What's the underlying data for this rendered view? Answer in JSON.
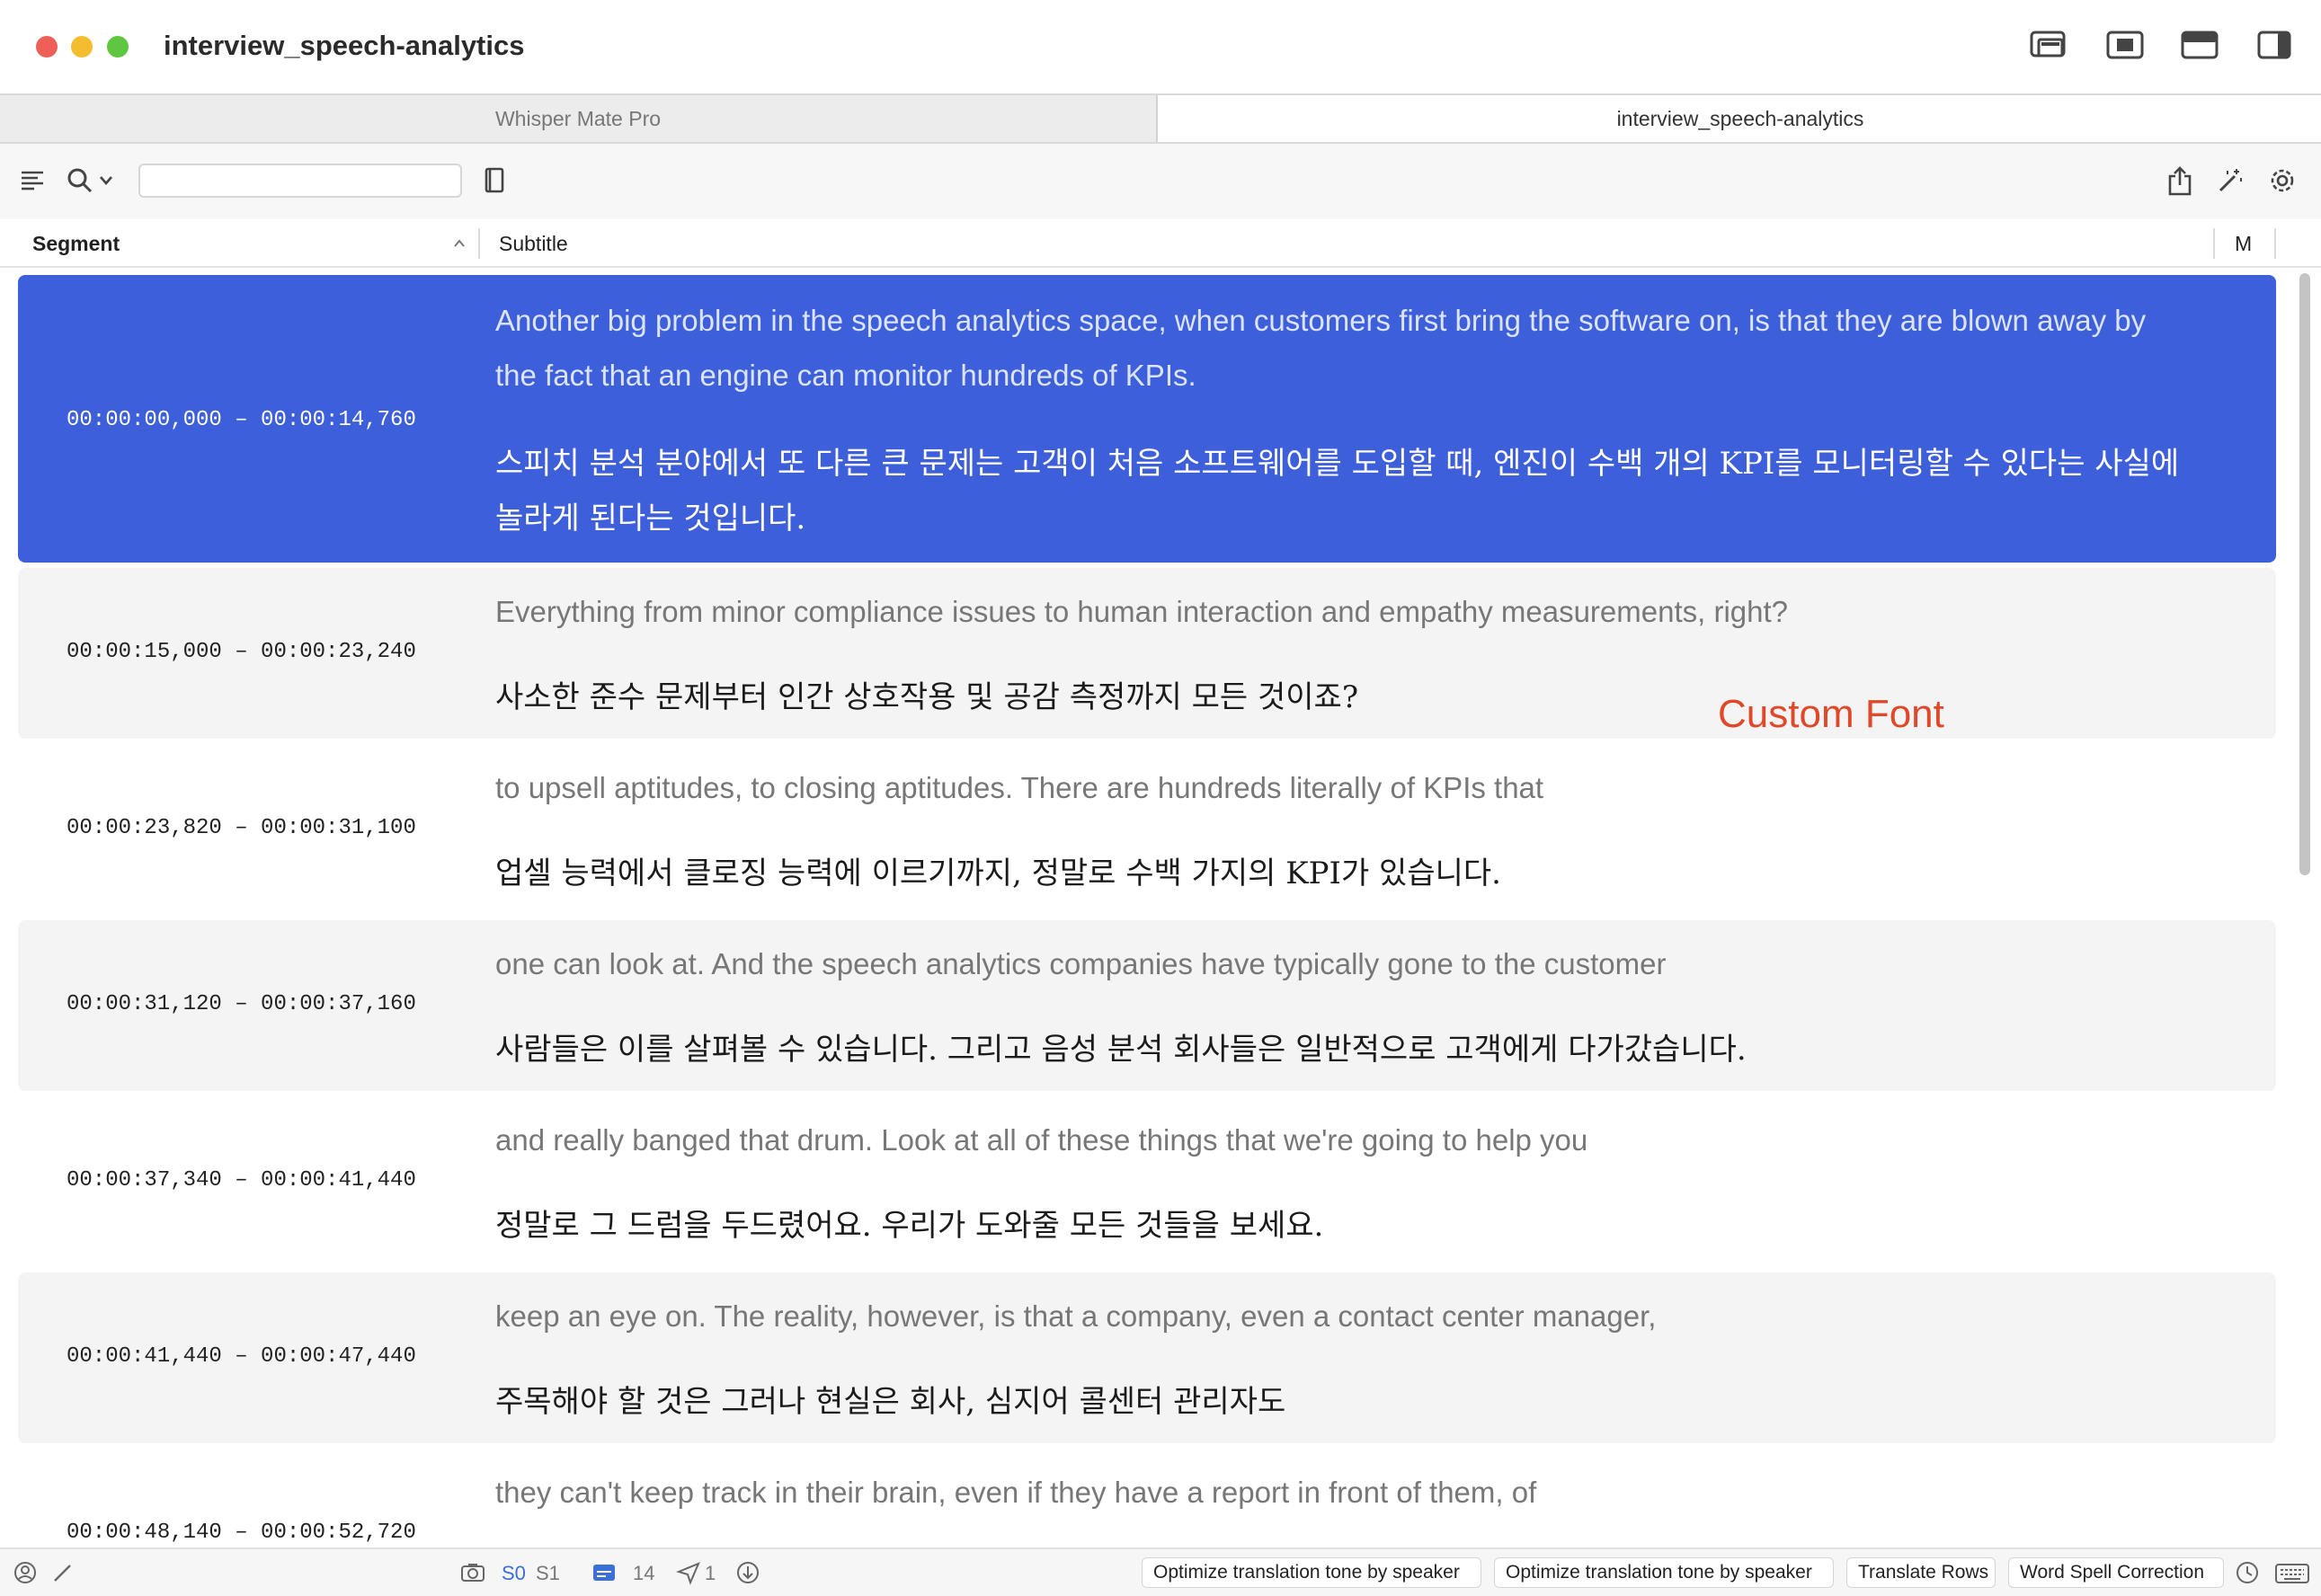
{
  "window": {
    "title": "interview_speech-analytics"
  },
  "tabs": [
    {
      "label": "Whisper Mate Pro"
    },
    {
      "label": "interview_speech-analytics"
    }
  ],
  "toolbar": {
    "search_value": ""
  },
  "columns": {
    "segment": "Segment",
    "subtitle": "Subtitle",
    "m": "M"
  },
  "rows": [
    {
      "time": "00:00:00,000 – 00:00:14,760",
      "en": "Another big problem in the speech analytics space, when customers first bring the software on, is that they are blown away by the fact that an engine can monitor hundreds of KPIs.",
      "ko": "스피치 분석 분야에서 또 다른 큰 문제는 고객이 처음 소프트웨어를 도입할 때, 엔진이 수백 개의 KPI를 모니터링할 수 있다는 사실에 놀라게 된다는 것입니다."
    },
    {
      "time": "00:00:15,000 – 00:00:23,240",
      "en": "Everything from minor compliance issues to human interaction and empathy measurements, right?",
      "ko": "사소한 준수 문제부터 인간 상호작용 및 공감 측정까지 모든 것이죠?"
    },
    {
      "time": "00:00:23,820 – 00:00:31,100",
      "en": "to upsell aptitudes, to closing aptitudes. There are hundreds literally of KPIs that",
      "ko": "업셀 능력에서 클로징 능력에 이르기까지, 정말로 수백 가지의 KPI가 있습니다."
    },
    {
      "time": "00:00:31,120 – 00:00:37,160",
      "en": "one can look at. And the speech analytics companies have typically gone to the customer",
      "ko": "사람들은 이를 살펴볼 수 있습니다. 그리고 음성 분석 회사들은 일반적으로 고객에게 다가갔습니다."
    },
    {
      "time": "00:00:37,340 – 00:00:41,440",
      "en": "and really banged that drum. Look at all of these things that we're going to help you",
      "ko": "정말로 그 드럼을 두드렸어요. 우리가 도와줄 모든 것들을 보세요."
    },
    {
      "time": "00:00:41,440 – 00:00:47,440",
      "en": "keep an eye on. The reality, however, is that a company, even a contact center manager,",
      "ko": "주목해야 할 것은 그러나 현실은 회사, 심지어 콜센터 관리자도"
    },
    {
      "time": "00:00:48,140 – 00:00:52,720",
      "en": "they can't keep track in their brain, even if they have a report in front of them, of",
      "ko": ""
    }
  ],
  "annotation": {
    "label": "Custom Font"
  },
  "status": {
    "s0": "S0",
    "s1": "S1",
    "count": "14",
    "sent": "1",
    "buttons": [
      "Optimize translation tone by speaker",
      "Optimize translation tone by speaker",
      "Translate Rows",
      "Word Spell Correction"
    ]
  },
  "colors": {
    "selected_row": "#3d5fd9",
    "annotation": "#e0482a",
    "accent": "#3b6fd6"
  },
  "icons": [
    "list-icon",
    "search-icon",
    "chevron-down-icon",
    "book-icon",
    "share-icon",
    "magic-wand-icon",
    "gear-icon",
    "person-icon",
    "pencil-icon",
    "camera-icon",
    "subtitle-icon",
    "send-icon",
    "download-icon",
    "clock-icon",
    "keyboard-icon"
  ]
}
